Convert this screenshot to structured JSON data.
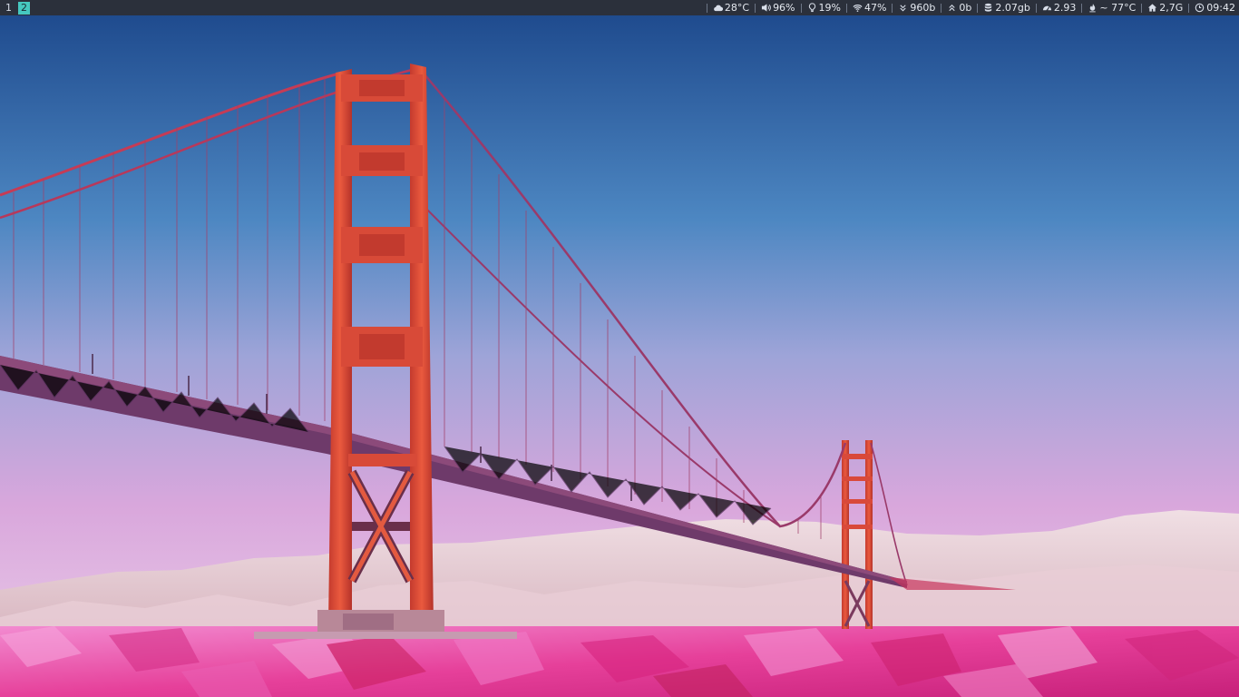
{
  "workspaces": [
    {
      "label": "1",
      "active": false
    },
    {
      "label": "2",
      "active": true
    }
  ],
  "status": {
    "weather": {
      "icon": "cloud-icon",
      "value": "28°C"
    },
    "volume": {
      "icon": "speaker-icon",
      "value": "96%"
    },
    "brightness": {
      "icon": "lightbulb-icon",
      "value": "19%"
    },
    "wifi": {
      "icon": "wifi-icon",
      "value": "47%"
    },
    "download": {
      "icon": "chevrons-down-icon",
      "value": "960b"
    },
    "upload": {
      "icon": "chevrons-up-icon",
      "value": "0b"
    },
    "memory": {
      "icon": "database-icon",
      "value": "2.07gb"
    },
    "load": {
      "icon": "dashboard-icon",
      "value": "2.93"
    },
    "temperature": {
      "icon": "fire-icon",
      "value": "~ 77°C"
    },
    "disk": {
      "icon": "home-icon",
      "value": "2,7G"
    },
    "clock": {
      "icon": "clock-icon",
      "value": "09:42"
    }
  },
  "colors": {
    "bar_background": "#2b303b",
    "bar_text": "#d8dee9",
    "active_workspace": "#46c8bf",
    "bridge_red": "#e0463a",
    "sky_top": "#1e4a8c",
    "sky_bottom": "#e6b8dc",
    "water_pink": "#e83f9c"
  },
  "wallpaper": {
    "icon": "golden-gate-bridge-wallpaper"
  }
}
